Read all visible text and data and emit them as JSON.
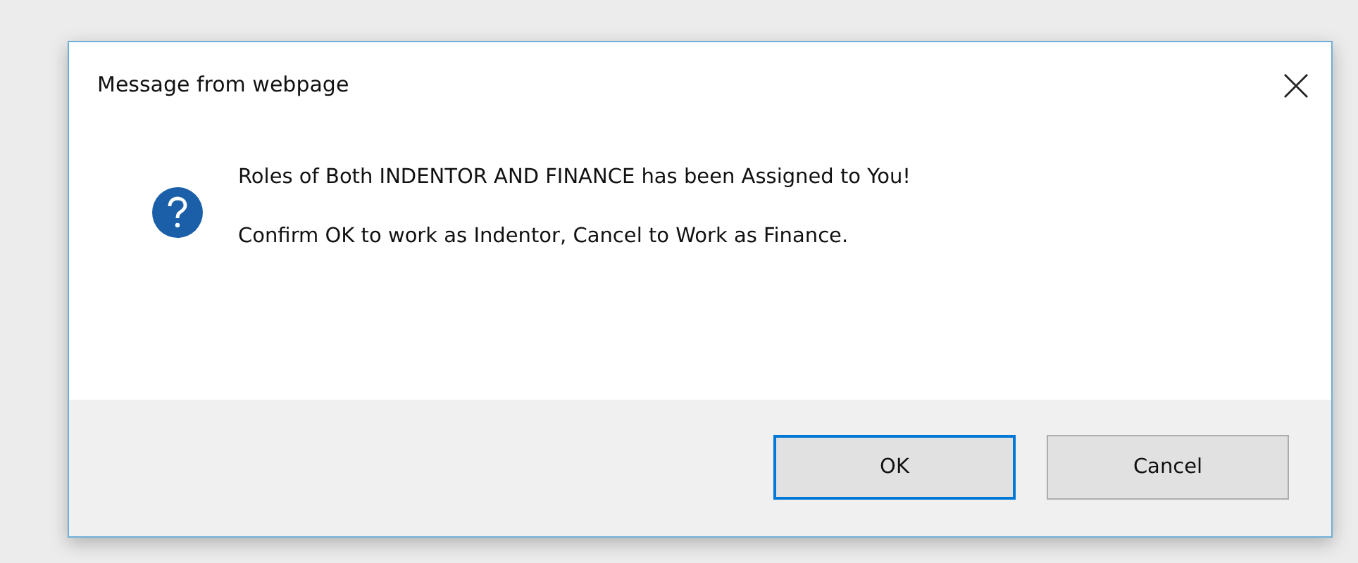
{
  "dialog": {
    "title": "Message from webpage",
    "messages": [
      "Roles of Both INDENTOR AND FINANCE has been Assigned to You!",
      "Confirm OK to work as Indentor, Cancel to Work as Finance."
    ],
    "buttons": [
      {
        "label": "OK",
        "selected": true
      },
      {
        "label": "Cancel",
        "selected": false
      }
    ]
  }
}
